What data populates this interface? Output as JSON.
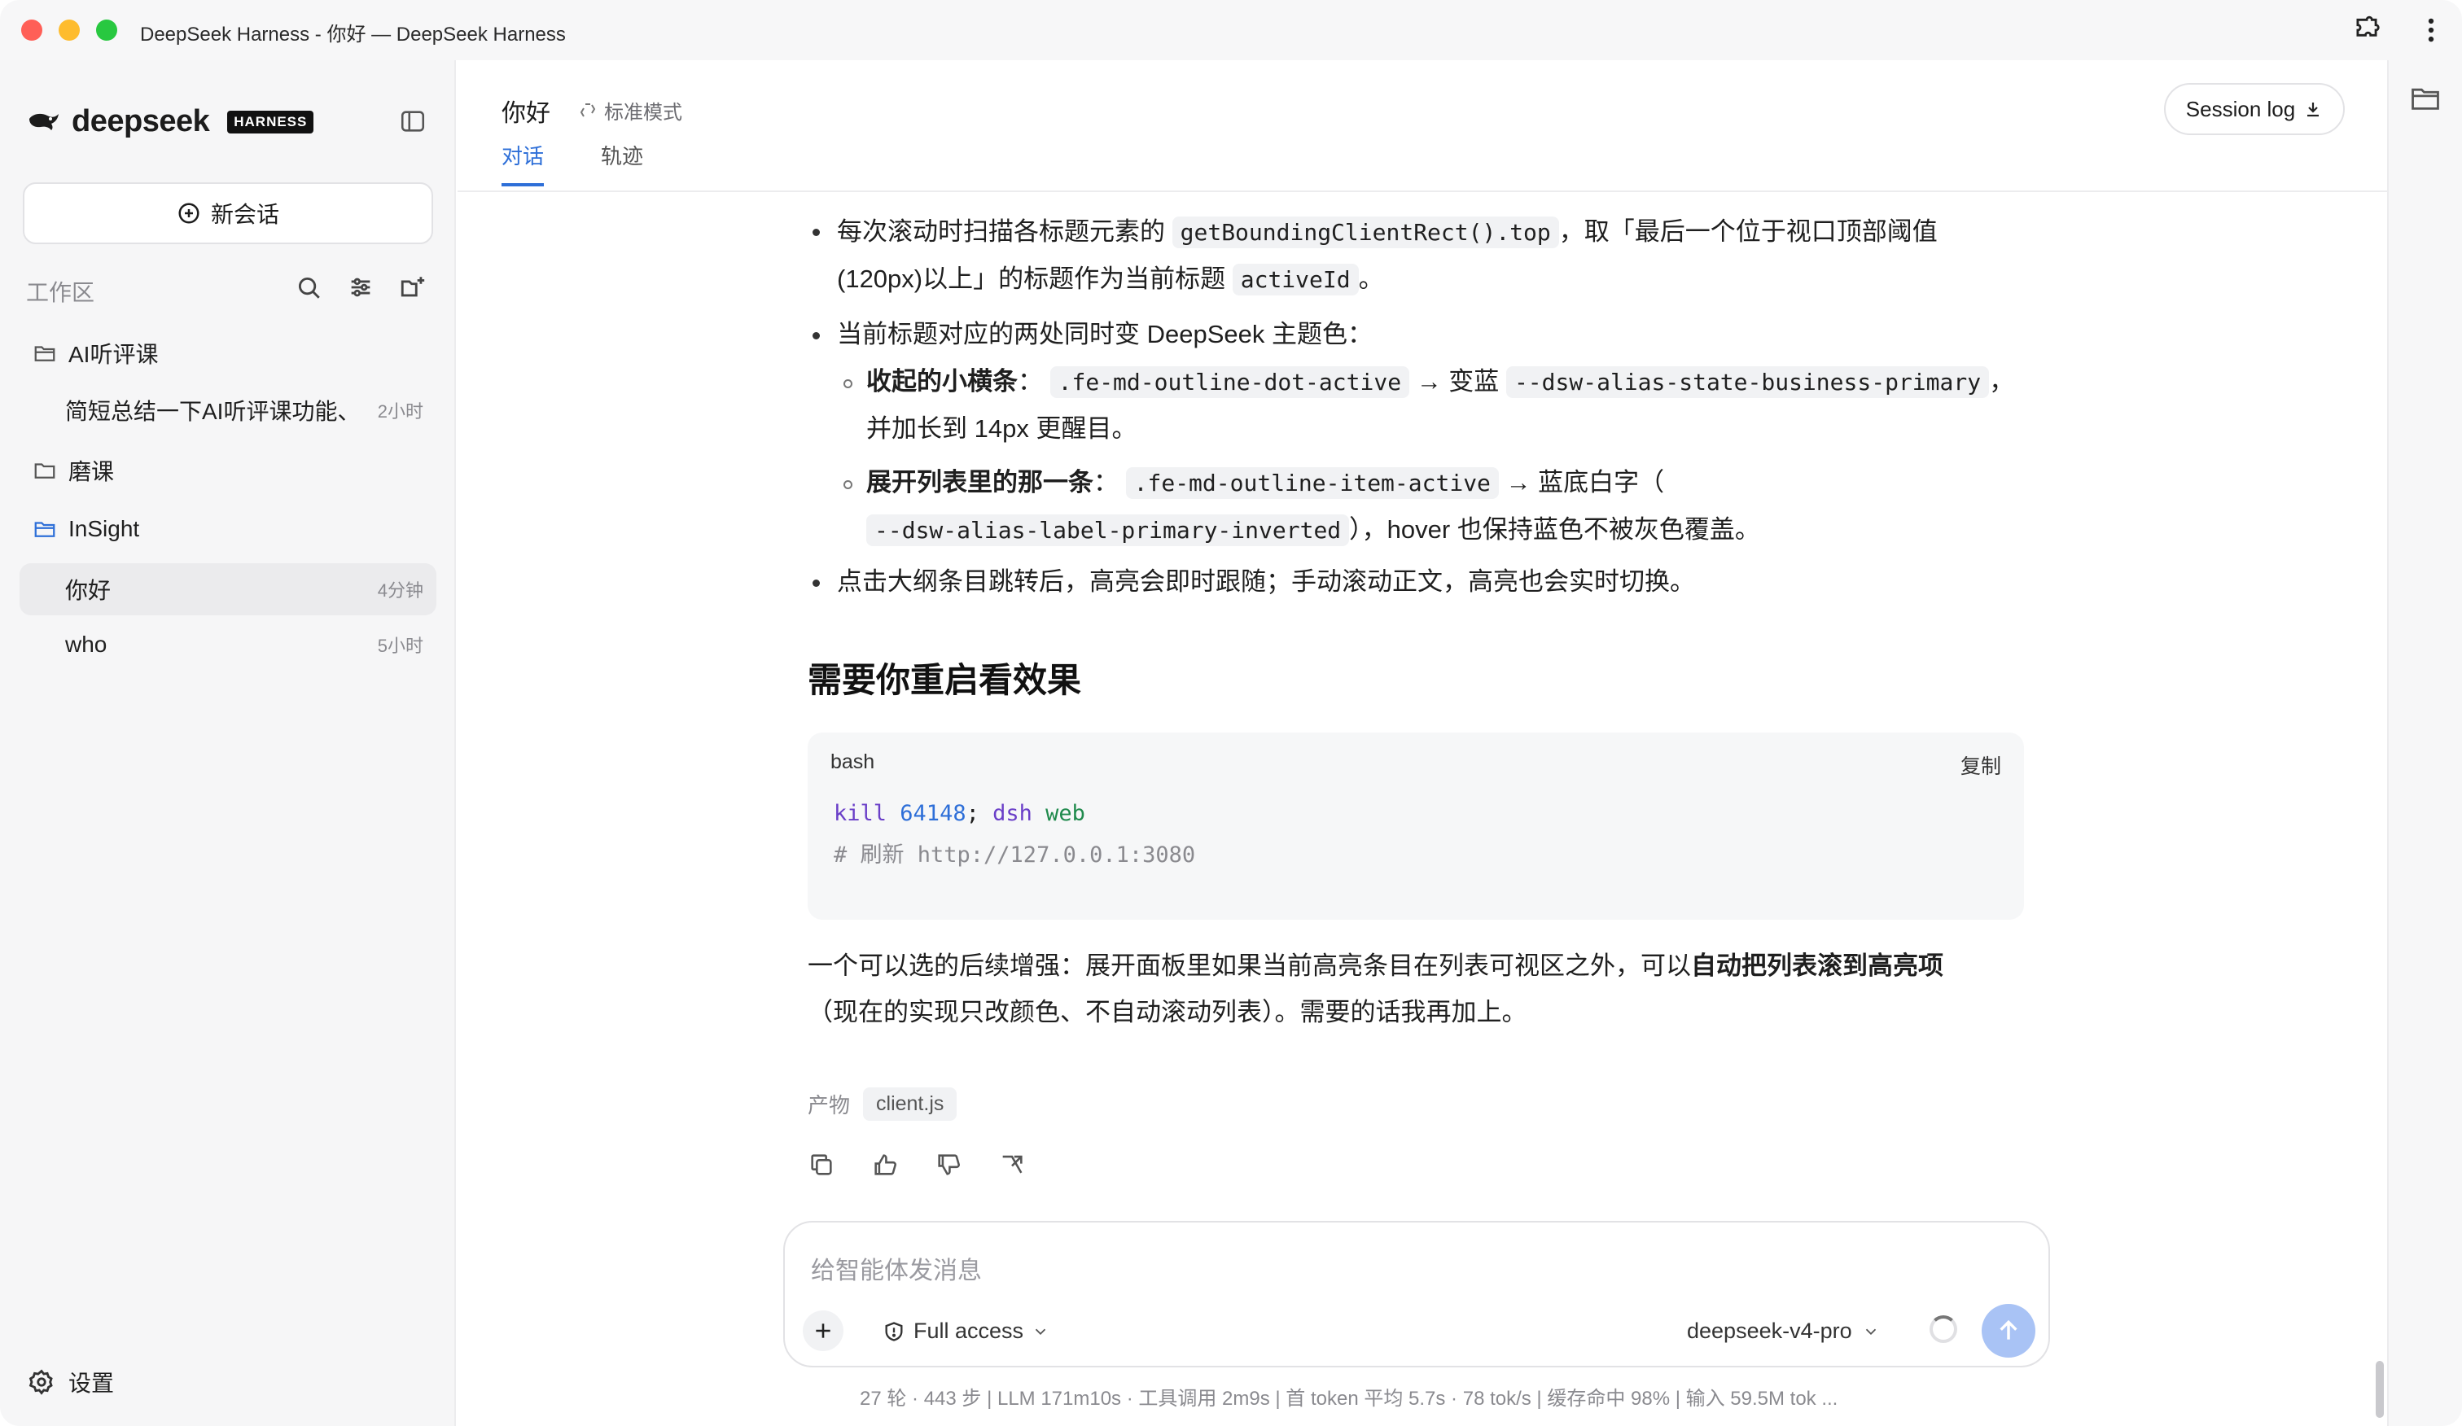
{
  "window": {
    "title": "DeepSeek Harness - 你好 — DeepSeek Harness",
    "traffic_colors": [
      "#ff5f57",
      "#febc2e",
      "#28c840"
    ]
  },
  "sidebar": {
    "logo_text": "deepseek",
    "logo_badge": "HARNESS",
    "new_chat_label": "新会话",
    "workspace_label": "工作区",
    "tree": [
      {
        "type": "folder",
        "label": "AI听评课",
        "open": false
      },
      {
        "type": "item",
        "label": "简短总结一下AI听评课功能、",
        "time": "2小时"
      },
      {
        "type": "folder",
        "label": "磨课",
        "open": false
      },
      {
        "type": "folder",
        "label": "InSight",
        "open": true
      },
      {
        "type": "item",
        "label": "你好",
        "time": "4分钟",
        "selected": true
      },
      {
        "type": "item",
        "label": "who",
        "time": "5小时"
      }
    ],
    "settings_label": "设置"
  },
  "header": {
    "title": "你好",
    "mode": "标准模式",
    "tabs": [
      "对话",
      "轨迹"
    ],
    "active_tab": "对话",
    "session_log_label": "Session log"
  },
  "message": {
    "bullet1_a": "每次滚动时扫描各标题元素的",
    "bullet1_code1": "getBoundingClientRect().top",
    "bullet1_b": "，取「最后一个位于视口顶部阈值",
    "bullet1_c": "(120px)以上」的标题作为当前标题",
    "bullet1_code2": "activeId",
    "bullet1_d": "。",
    "bullet2": "当前标题对应的两处同时变 DeepSeek 主题色：",
    "sub1_bold": "收起的小横条",
    "sub1_colon": "：",
    "sub1_code1": ".fe-md-outline-dot-active",
    "sub1_arrow": "→ 变蓝",
    "sub1_code2": "--dsw-alias-state-business-primary",
    "sub1_comma": "，",
    "sub1_line2": "并加长到 14px 更醒目。",
    "sub2_bold": "展开列表里的那一条",
    "sub2_colon": "：",
    "sub2_code1": ".fe-md-outline-item-active",
    "sub2_arrow": "→ 蓝底白字（",
    "sub2_code2": "--dsw-alias-label-primary-inverted",
    "sub2_tail": "），hover 也保持蓝色不被灰色覆盖。",
    "bullet3": "点击大纲条目跳转后，高亮会即时跟随；手动滚动正文，高亮也会实时切换。",
    "heading": "需要你重启看效果",
    "code_lang": "bash",
    "code_copy": "复制",
    "code_kw1": "kill",
    "code_num": "64148",
    "code_sep": ";",
    "code_kw2": "dsh",
    "code_arg": "web",
    "code_comment": "# 刷新 http://127.0.0.1:3080",
    "para_a": "一个可以选的后续增强：展开面板里如果当前高亮条目在列表可视区之外，可以",
    "para_bold": "自动把列表滚到高亮项",
    "para_b": "（现在的实现只改颜色、不自动滚动列表）。需要的话我再加上。",
    "artifact_label": "产物",
    "artifact_file": "client.js"
  },
  "composer": {
    "placeholder": "给智能体发消息",
    "access_label": "Full access",
    "model_label": "deepseek-v4-pro"
  },
  "stats": {
    "text": "27 轮 · 443 步   |   LLM 171m10s · 工具调用 2m9s   |   首 token 平均 5.7s · 78 tok/s   |   缓存命中 98%   |   输入 59.5M tok ..."
  },
  "colors": {
    "accent": "#2e6fd8",
    "send_button": "#a9c3f5",
    "code_keyword": "#6a3fc8",
    "code_number": "#2e6fd8",
    "code_string": "#1f8a4c"
  }
}
